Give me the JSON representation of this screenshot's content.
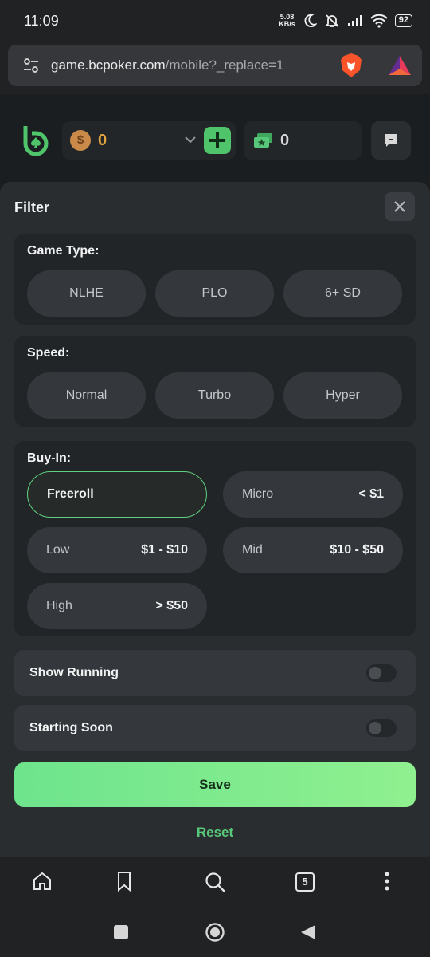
{
  "status_bar": {
    "time": "11:09",
    "net_speed_value": "5.08",
    "net_speed_unit": "KB/s",
    "battery": "92"
  },
  "browser": {
    "url_domain": "game.bcpoker.com",
    "url_path": "/mobile?_replace=1",
    "tab_count": "5"
  },
  "header": {
    "balance": "0",
    "bonus_balance": "0",
    "coin_symbol": "$"
  },
  "filter": {
    "title": "Filter",
    "game_type": {
      "label": "Game Type:",
      "options": [
        "NLHE",
        "PLO",
        "6+ SD"
      ]
    },
    "speed": {
      "label": "Speed:",
      "options": [
        "Normal",
        "Turbo",
        "Hyper"
      ]
    },
    "buy_in": {
      "label": "Buy-In:",
      "options": [
        {
          "name": "Freeroll",
          "range": "",
          "selected": true
        },
        {
          "name": "Micro",
          "range": "< $1",
          "selected": false
        },
        {
          "name": "Low",
          "range": "$1 - $10",
          "selected": false
        },
        {
          "name": "Mid",
          "range": "$10 - $50",
          "selected": false
        },
        {
          "name": "High",
          "range": "> $50",
          "selected": false
        }
      ]
    },
    "show_running": {
      "label": "Show Running",
      "on": false
    },
    "starting_soon": {
      "label": "Starting Soon",
      "on": false
    },
    "save_label": "Save",
    "reset_label": "Reset"
  },
  "colors": {
    "accent_green": "#5fd27f",
    "balance_gold": "#e0a33e",
    "panel_bg": "#2a2d30"
  }
}
